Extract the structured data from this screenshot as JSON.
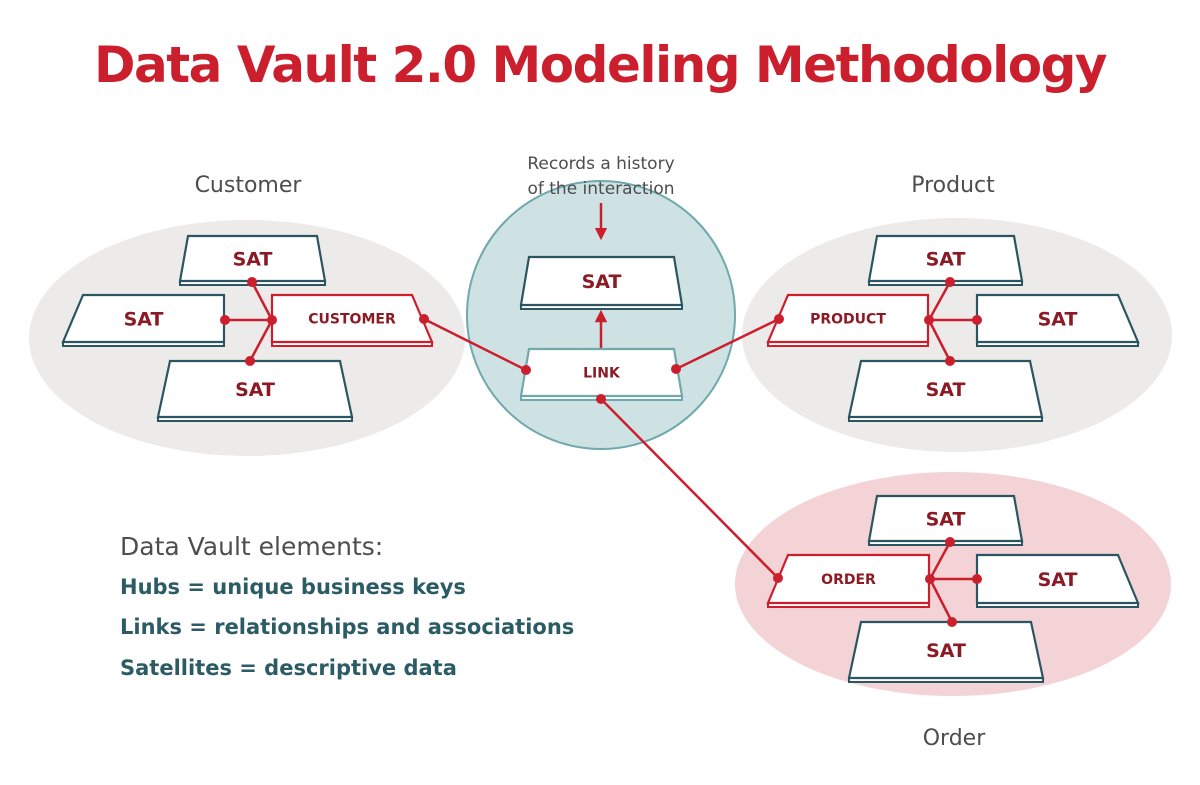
{
  "title": "Data Vault 2.0 Modeling Methodology",
  "colors": {
    "title": "#cc1f2d",
    "connector": "#cc1f2d",
    "sat_border": "#2b5661",
    "hub_border": "#cc1f2d",
    "link_border": "#6fa8ad",
    "label_text": "#8b1a24",
    "customer_bg": "#ecebea",
    "product_bg": "#ecebea",
    "link_bg": "#cfe2e3",
    "order_bg": "#f3d3d5",
    "legend_text": "#2b5b64",
    "gray_text": "#4d4d4f"
  },
  "groups": {
    "customer": {
      "label": "Customer",
      "hub": "CUSTOMER",
      "sats": [
        "SAT",
        "SAT",
        "SAT"
      ]
    },
    "product": {
      "label": "Product",
      "hub": "PRODUCT",
      "sats": [
        "SAT",
        "SAT",
        "SAT"
      ]
    },
    "order": {
      "label": "Order",
      "hub": "ORDER",
      "sats": [
        "SAT",
        "SAT",
        "SAT"
      ]
    },
    "link": {
      "annotation": [
        "Records a history",
        "of the interaction"
      ],
      "link": "LINK",
      "sat": "SAT"
    }
  },
  "legend": {
    "heading": "Data Vault elements:",
    "items": [
      "Hubs = unique business keys",
      "Links = relationships and associations",
      "Satellites = descriptive data"
    ]
  }
}
